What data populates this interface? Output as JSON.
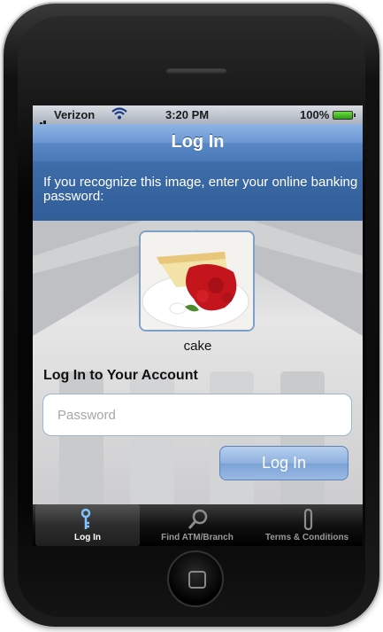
{
  "status_bar": {
    "carrier": "Verizon",
    "time": "3:20 PM",
    "battery": "100%"
  },
  "nav": {
    "title": "Log In"
  },
  "prompt": {
    "text": "If you recognize this image, enter your online banking password:"
  },
  "security_image": {
    "caption": "cake"
  },
  "login_form": {
    "title": "Log In to Your Account",
    "password_placeholder": "Password",
    "password_value": "",
    "button_label": "Log In"
  },
  "tabs": [
    {
      "label": "Log In",
      "icon": "key-icon",
      "active": true
    },
    {
      "label": "Find ATM/Branch",
      "icon": "search-icon",
      "active": false
    },
    {
      "label": "Terms & Conditions",
      "icon": "paperclip-icon",
      "active": false
    }
  ],
  "colors": {
    "nav_blue": "#5a88c6",
    "prompt_blue": "#3e6da9",
    "button_blue": "#8fb2e0"
  }
}
